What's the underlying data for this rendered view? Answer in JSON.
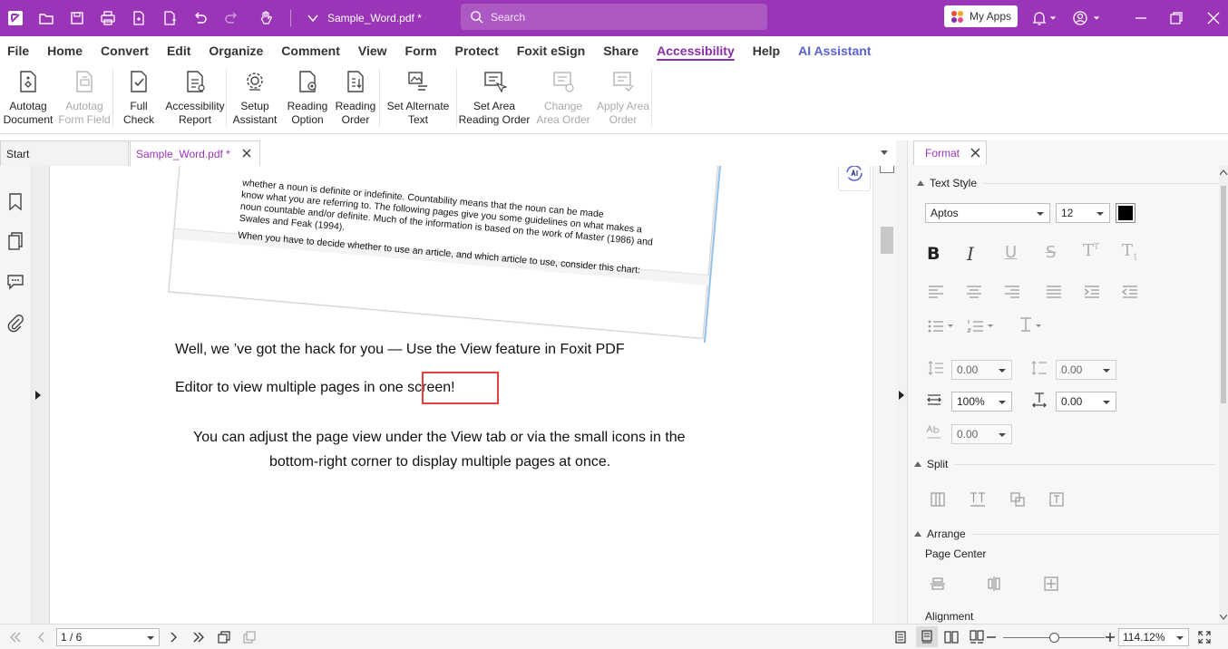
{
  "titlebar": {
    "document_title": "Sample_Word.pdf *",
    "search_placeholder": "Search",
    "my_apps_label": "My Apps",
    "accent_color": "#9b35b8"
  },
  "menu": {
    "items": [
      "File",
      "Home",
      "Convert",
      "Edit",
      "Organize",
      "Comment",
      "View",
      "Form",
      "Protect",
      "Foxit eSign",
      "Share",
      "Accessibility",
      "Help",
      "AI Assistant"
    ],
    "active": "Accessibility"
  },
  "ribbon": {
    "autotag_document": [
      "Autotag",
      "Document"
    ],
    "autotag_form_field": [
      "Autotag",
      "Form Field"
    ],
    "full_check": [
      "Full",
      "Check"
    ],
    "accessibility_report": [
      "Accessibility",
      "Report"
    ],
    "setup_assistant": [
      "Setup",
      "Assistant"
    ],
    "reading_option": [
      "Reading",
      "Option"
    ],
    "reading_order": [
      "Reading",
      "Order"
    ],
    "set_alternate_text": [
      "Set Alternate",
      "Text"
    ],
    "set_area_reading_order": [
      "Set Area",
      "Reading Order"
    ],
    "change_area_order": [
      "Change",
      "Area Order"
    ],
    "apply_area_order": [
      "Apply Area",
      "Order"
    ]
  },
  "tabs": {
    "start": "Start",
    "document": "Sample_Word.pdf *"
  },
  "document": {
    "screenshot_lines": [
      "whether a noun is definite or indefinite. Countability means that the noun can be made",
      "know what you are referring to. The following pages give you some guidelines on what makes a",
      "noun countable and/or definite. Much of the information is based on the work of Master (1986) and",
      "Swales and Feak (1994).",
      "When you have to decide whether to use an article, and which article to use, consider this chart:"
    ],
    "line1": "Well, we ’ve got the hack for you  —  Use the View feature in Foxit PDF",
    "line2": "Editor to view multiple pages in one screen!",
    "line3": "You can adjust the page view under the View tab or via the small icons in the",
    "line4": "bottom-right corner to display multiple pages at once."
  },
  "format_panel": {
    "tab_label": "Format",
    "text_style_label": "Text Style",
    "font_name": "Aptos",
    "font_size": "12",
    "line_spacing": "0.00",
    "paragraph_spacing": "0.00",
    "horizontal_scale": "100%",
    "char_spacing": "0.00",
    "word_spacing": "0.00",
    "split_label": "Split",
    "arrange_label": "Arrange",
    "page_center_label": "Page Center",
    "alignment_label": "Alignment"
  },
  "statusbar": {
    "page_indicator": "1 / 6",
    "zoom": "114.12%",
    "zoom_fraction": 0.45
  }
}
